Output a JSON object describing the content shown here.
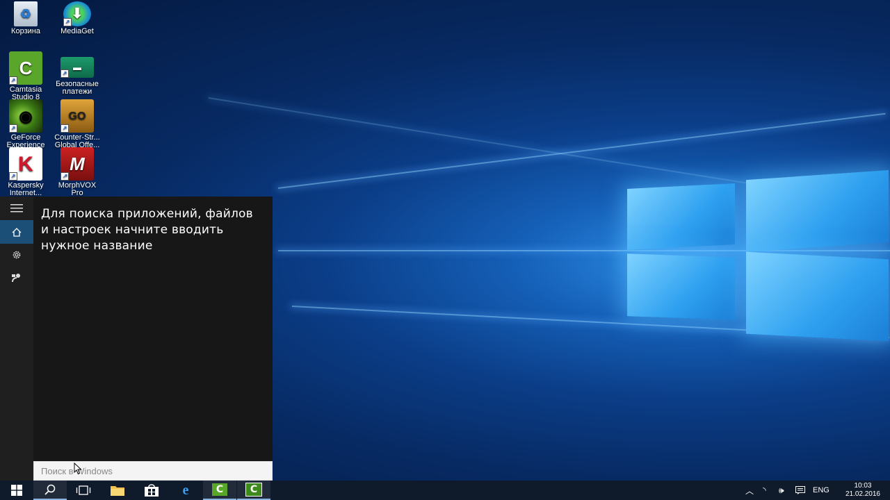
{
  "desktop": {
    "icons": [
      {
        "label": "Корзина",
        "name": "recycle-bin"
      },
      {
        "label": "MediaGet",
        "name": "mediaget"
      },
      {
        "label": "Camtasia Studio 8",
        "name": "camtasia"
      },
      {
        "label": "Безопасные платежи",
        "name": "safe-payments"
      },
      {
        "label": "GeForce Experience",
        "name": "geforce"
      },
      {
        "label": "Counter-Str... Global Offe...",
        "name": "csgo"
      },
      {
        "label": "Kaspersky Internet...",
        "name": "kaspersky"
      },
      {
        "label": "MorphVOX Pro",
        "name": "morphvox"
      }
    ]
  },
  "start_panel": {
    "hint": "Для поиска приложений, файлов и настроек начните вводить нужное название",
    "search_placeholder": "Поиск в Windows"
  },
  "taskbar": {
    "language": "ENG",
    "time": "10:03",
    "date": "21.02.2016"
  },
  "colors": {
    "accent": "#1b4f78",
    "taskbar": "#0f1a2a"
  }
}
